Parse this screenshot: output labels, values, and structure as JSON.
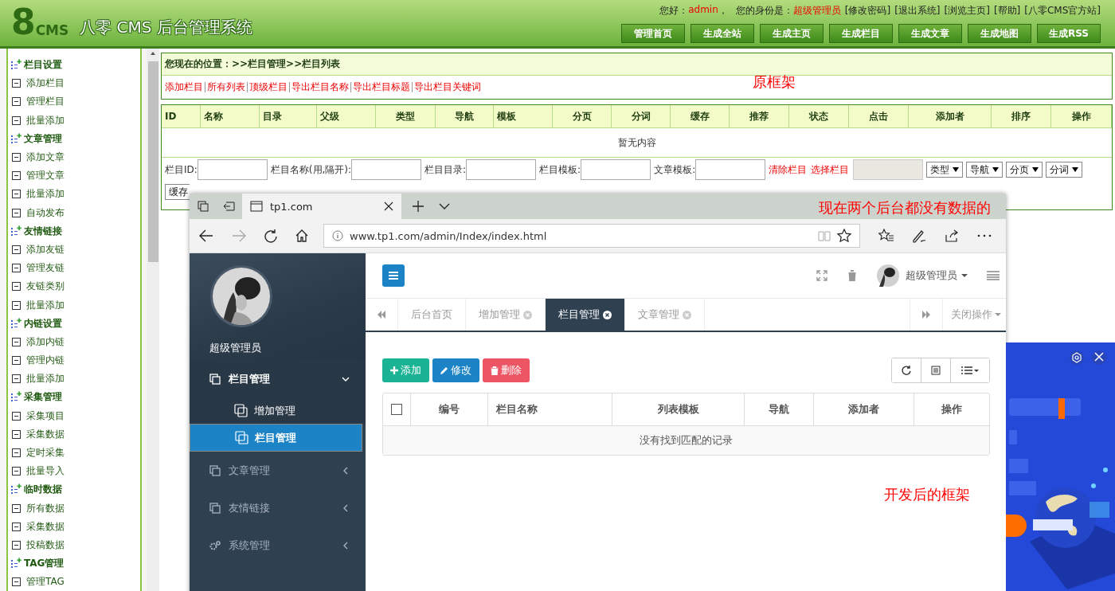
{
  "header": {
    "logo": {
      "numeral": "8",
      "letters": "CMS"
    },
    "title": "八零 CMS 后台管理系统",
    "user_bar": {
      "greeting": "您好：",
      "user": "admin",
      "separator": "，",
      "role_label": "您的身份是：",
      "role": "超级管理员",
      "links": [
        "[修改密码]",
        "[退出系统]",
        "[浏览主页]",
        "[帮助]",
        "[八零CMS官方站]"
      ]
    },
    "nav": [
      "管理首页",
      "生成全站",
      "生成主页",
      "生成栏目",
      "生成文章",
      "生成地图",
      "生成RSS"
    ]
  },
  "sidebar": {
    "groups": [
      {
        "title": "栏目设置",
        "children": [
          {
            "label": "添加栏目"
          },
          {
            "label": "管理栏目"
          },
          {
            "label": "批量添加"
          }
        ]
      },
      {
        "title": "文章管理",
        "children": [
          {
            "label": "添加文章"
          },
          {
            "label": "管理文章"
          },
          {
            "label": "批量添加"
          },
          {
            "label": "自动发布"
          }
        ]
      },
      {
        "title": "友情链接",
        "children": [
          {
            "label": "添加友链"
          },
          {
            "label": "管理友链"
          },
          {
            "label": "友链类别"
          },
          {
            "label": "批量添加"
          }
        ]
      },
      {
        "title": "内链设置",
        "children": [
          {
            "label": "添加内链"
          },
          {
            "label": "管理内链"
          },
          {
            "label": "批量添加"
          }
        ]
      },
      {
        "title": "采集管理",
        "children": [
          {
            "label": "采集项目"
          },
          {
            "label": "采集数据"
          },
          {
            "label": "定时采集"
          },
          {
            "label": "批量导入"
          }
        ]
      },
      {
        "title": "临时数据",
        "children": [
          {
            "label": "所有数据"
          },
          {
            "label": "采集数据"
          },
          {
            "label": "投稿数据"
          }
        ]
      },
      {
        "title": "TAG管理",
        "children": [
          {
            "label": "管理TAG"
          }
        ]
      }
    ]
  },
  "breadcrumb": {
    "label": "您现在的位置：",
    "path": ">>栏目管理>>栏目列表"
  },
  "actions": [
    "添加栏目",
    "所有列表",
    "顶级栏目",
    "导出栏目名称",
    "导出栏目标题",
    "导出栏目关键词"
  ],
  "table": {
    "columns": [
      "ID",
      "名称",
      "目录",
      "父级",
      "类型",
      "导航",
      "模板",
      "分页",
      "分词",
      "缓存",
      "推荐",
      "状态",
      "点击",
      "添加者",
      "排序",
      "操作"
    ],
    "empty": "暂无内容"
  },
  "filters": {
    "fields": [
      {
        "label": "栏目ID:"
      },
      {
        "label": "栏目名称(用,隔开):"
      },
      {
        "label": "栏目目录:"
      },
      {
        "label": "栏目模板:"
      },
      {
        "label": "文章模板:"
      }
    ],
    "links": [
      "清除栏目",
      "选择栏目"
    ],
    "picker": {
      "disabled": true
    },
    "selects": [
      "类型",
      "导航",
      "分页",
      "分词"
    ],
    "selects_2": [
      "缓存"
    ]
  },
  "annotations": [
    {
      "text": "原框架"
    },
    {
      "text": "现在两个后台都没有数据的"
    },
    {
      "text": "开发后的框架"
    }
  ],
  "browser": {
    "tab_title": "tp1.com",
    "url": "www.tp1.com/admin/Index/index.html"
  },
  "admin": {
    "profile_name": "超级管理员",
    "user": "超级管理员",
    "menu": [
      {
        "label": "栏目管理",
        "kind": "copy",
        "expanded": true,
        "children": [
          {
            "label": "增加管理",
            "selected": false
          },
          {
            "label": "栏目管理",
            "selected": true
          }
        ]
      },
      {
        "label": "文章管理",
        "kind": "copy",
        "expanded": false
      },
      {
        "label": "友情链接",
        "kind": "copy",
        "expanded": false
      },
      {
        "label": "系统管理",
        "kind": "gears",
        "expanded": false
      }
    ],
    "tabs": [
      {
        "label": "后台首页",
        "closable": false,
        "selected": false
      },
      {
        "label": "增加管理",
        "closable": true,
        "selected": false
      },
      {
        "label": "栏目管理",
        "closable": true,
        "selected": true
      },
      {
        "label": "文章管理",
        "closable": true,
        "selected": false
      }
    ],
    "close_menu": "关闭操作",
    "buttons": [
      {
        "kind": "add",
        "label": "添加"
      },
      {
        "kind": "edit",
        "label": "修改"
      },
      {
        "kind": "delete",
        "label": "删除"
      }
    ],
    "grid": {
      "checked": false,
      "columns": [
        "编号",
        "栏目名称",
        "列表模板",
        "导航",
        "添加者",
        "操作"
      ],
      "empty": "没有找到匹配的记录"
    }
  },
  "ad": {
    "kind": "picture"
  }
}
